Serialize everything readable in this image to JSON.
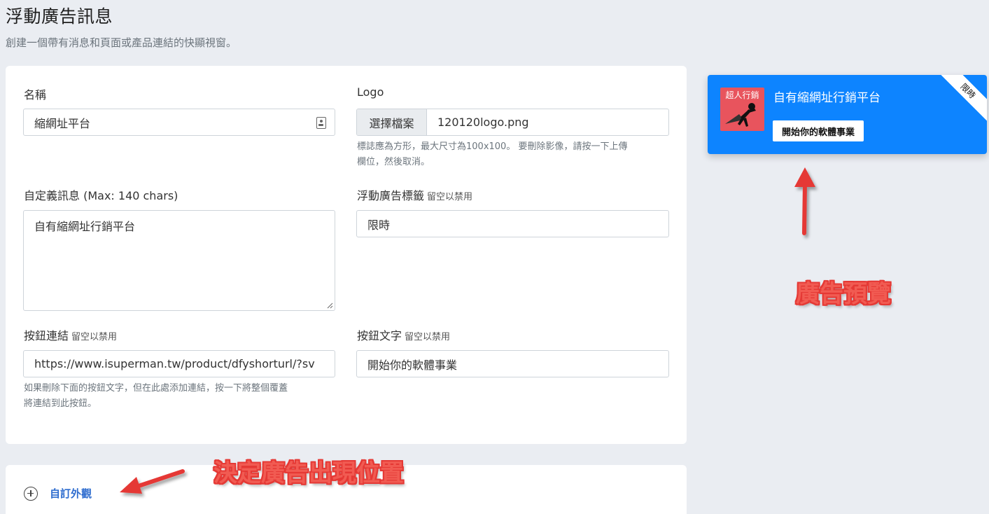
{
  "page": {
    "title": "浮動廣告訊息",
    "subtitle": "創建一個帶有消息和頁面或產品連結的快顯視窗。"
  },
  "form": {
    "name": {
      "label": "名稱",
      "value": "縮網址平台"
    },
    "logo": {
      "label": "Logo",
      "button": "選擇檔案",
      "filename": "120120logo.png",
      "help_line1": "標誌應為方形，最大尺寸為100x100。 要刪除影像，請按一下上傳",
      "help_line2": "欄位，然後取消。"
    },
    "message": {
      "label": "自定義訊息 (Max: 140 chars)",
      "value": "自有縮網址行銷平台"
    },
    "ribbon": {
      "label": "浮動廣告標籤",
      "hint": "留空以禁用",
      "value": "限時"
    },
    "button_link": {
      "label": "按鈕連結",
      "hint": "留空以禁用",
      "value": "https://www.isuperman.tw/product/dfyshorturl/?sv",
      "help_line1": "如果刪除下面的按鈕文字，但在此處添加連結，按一下將整個覆蓋",
      "help_line2": "將連結到此按鈕。"
    },
    "button_text": {
      "label": "按鈕文字",
      "hint": "留空以禁用",
      "value": "開始你的軟體事業"
    }
  },
  "customize": {
    "label": "自訂外觀"
  },
  "preview": {
    "logo_text": "超人行銷",
    "message": "自有縮網址行銷平台",
    "button": "開始你的軟體事業",
    "ribbon": "限時",
    "background_color": "#0d84ff",
    "logo_color": "#e8545d"
  },
  "annotations": {
    "preview_note": "廣告預覽",
    "position_note": "決定廣告出現位置"
  }
}
